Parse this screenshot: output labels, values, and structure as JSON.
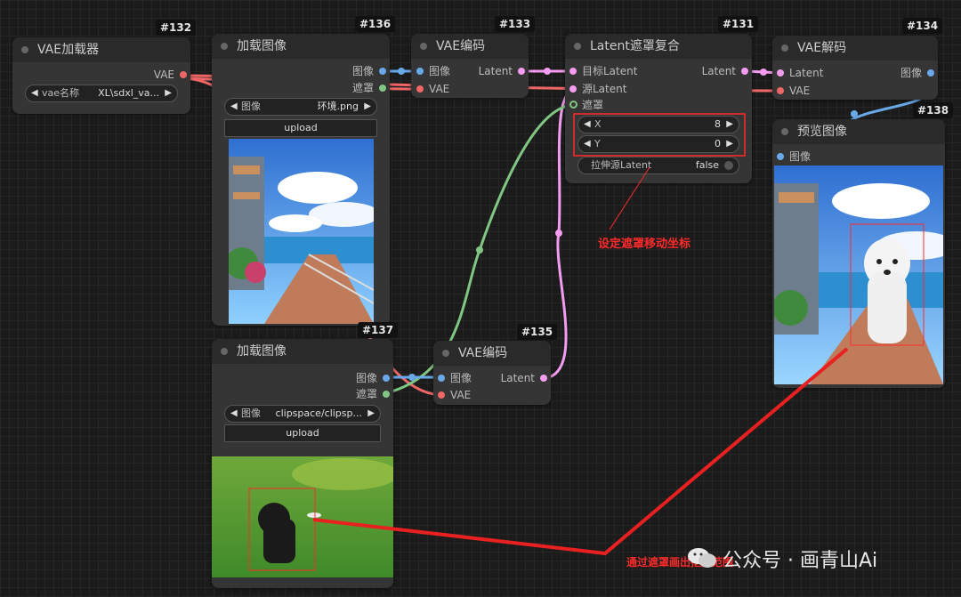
{
  "nodes": {
    "vae_loader": {
      "id": "#132",
      "title": "VAE加载器",
      "out_vae": "VAE",
      "widget_label": "vae名称",
      "widget_value": "XL\\sdxl_va..."
    },
    "load_image_1": {
      "id": "#136",
      "title": "加载图像",
      "out_image": "图像",
      "out_mask": "遮罩",
      "widget_label": "图像",
      "widget_value": "环境.png",
      "upload": "upload"
    },
    "vae_encode_1": {
      "id": "#133",
      "title": "VAE编码",
      "in_image": "图像",
      "in_vae": "VAE",
      "out_latent": "Latent"
    },
    "latent_composite": {
      "id": "#131",
      "title": "Latent遮罩复合",
      "in_target": "目标Latent",
      "in_source": "源Latent",
      "in_mask": "遮罩",
      "out_latent": "Latent",
      "x_label": "X",
      "x_value": "8",
      "y_label": "Y",
      "y_value": "0",
      "toggle_label": "拉伸源Latent",
      "toggle_value": "false"
    },
    "vae_decode": {
      "id": "#134",
      "title": "VAE解码",
      "in_latent": "Latent",
      "in_vae": "VAE",
      "out_image": "图像"
    },
    "preview": {
      "id": "#138",
      "title": "预览图像",
      "in_image": "图像"
    },
    "load_image_2": {
      "id": "#137",
      "title": "加载图像",
      "out_image": "图像",
      "out_mask": "遮罩",
      "widget_label": "图像",
      "widget_value": "clipspace/clipsp...",
      "upload": "upload"
    },
    "vae_encode_2": {
      "id": "#135",
      "title": "VAE编码",
      "in_image": "图像",
      "in_vae": "VAE",
      "out_latent": "Latent"
    }
  },
  "annotations": {
    "coord_note": "设定遮罩移动坐标",
    "mask_note": "通过遮罩画出抠图范围",
    "watermark": "公众号 · 画青山Ai"
  },
  "colors": {
    "image_wire": "#6aa9e9",
    "vae_wire": "#ee6666",
    "latent_wire": "#f39cf0",
    "mask_wire": "#81c784",
    "annotation": "#ff2a2a"
  }
}
